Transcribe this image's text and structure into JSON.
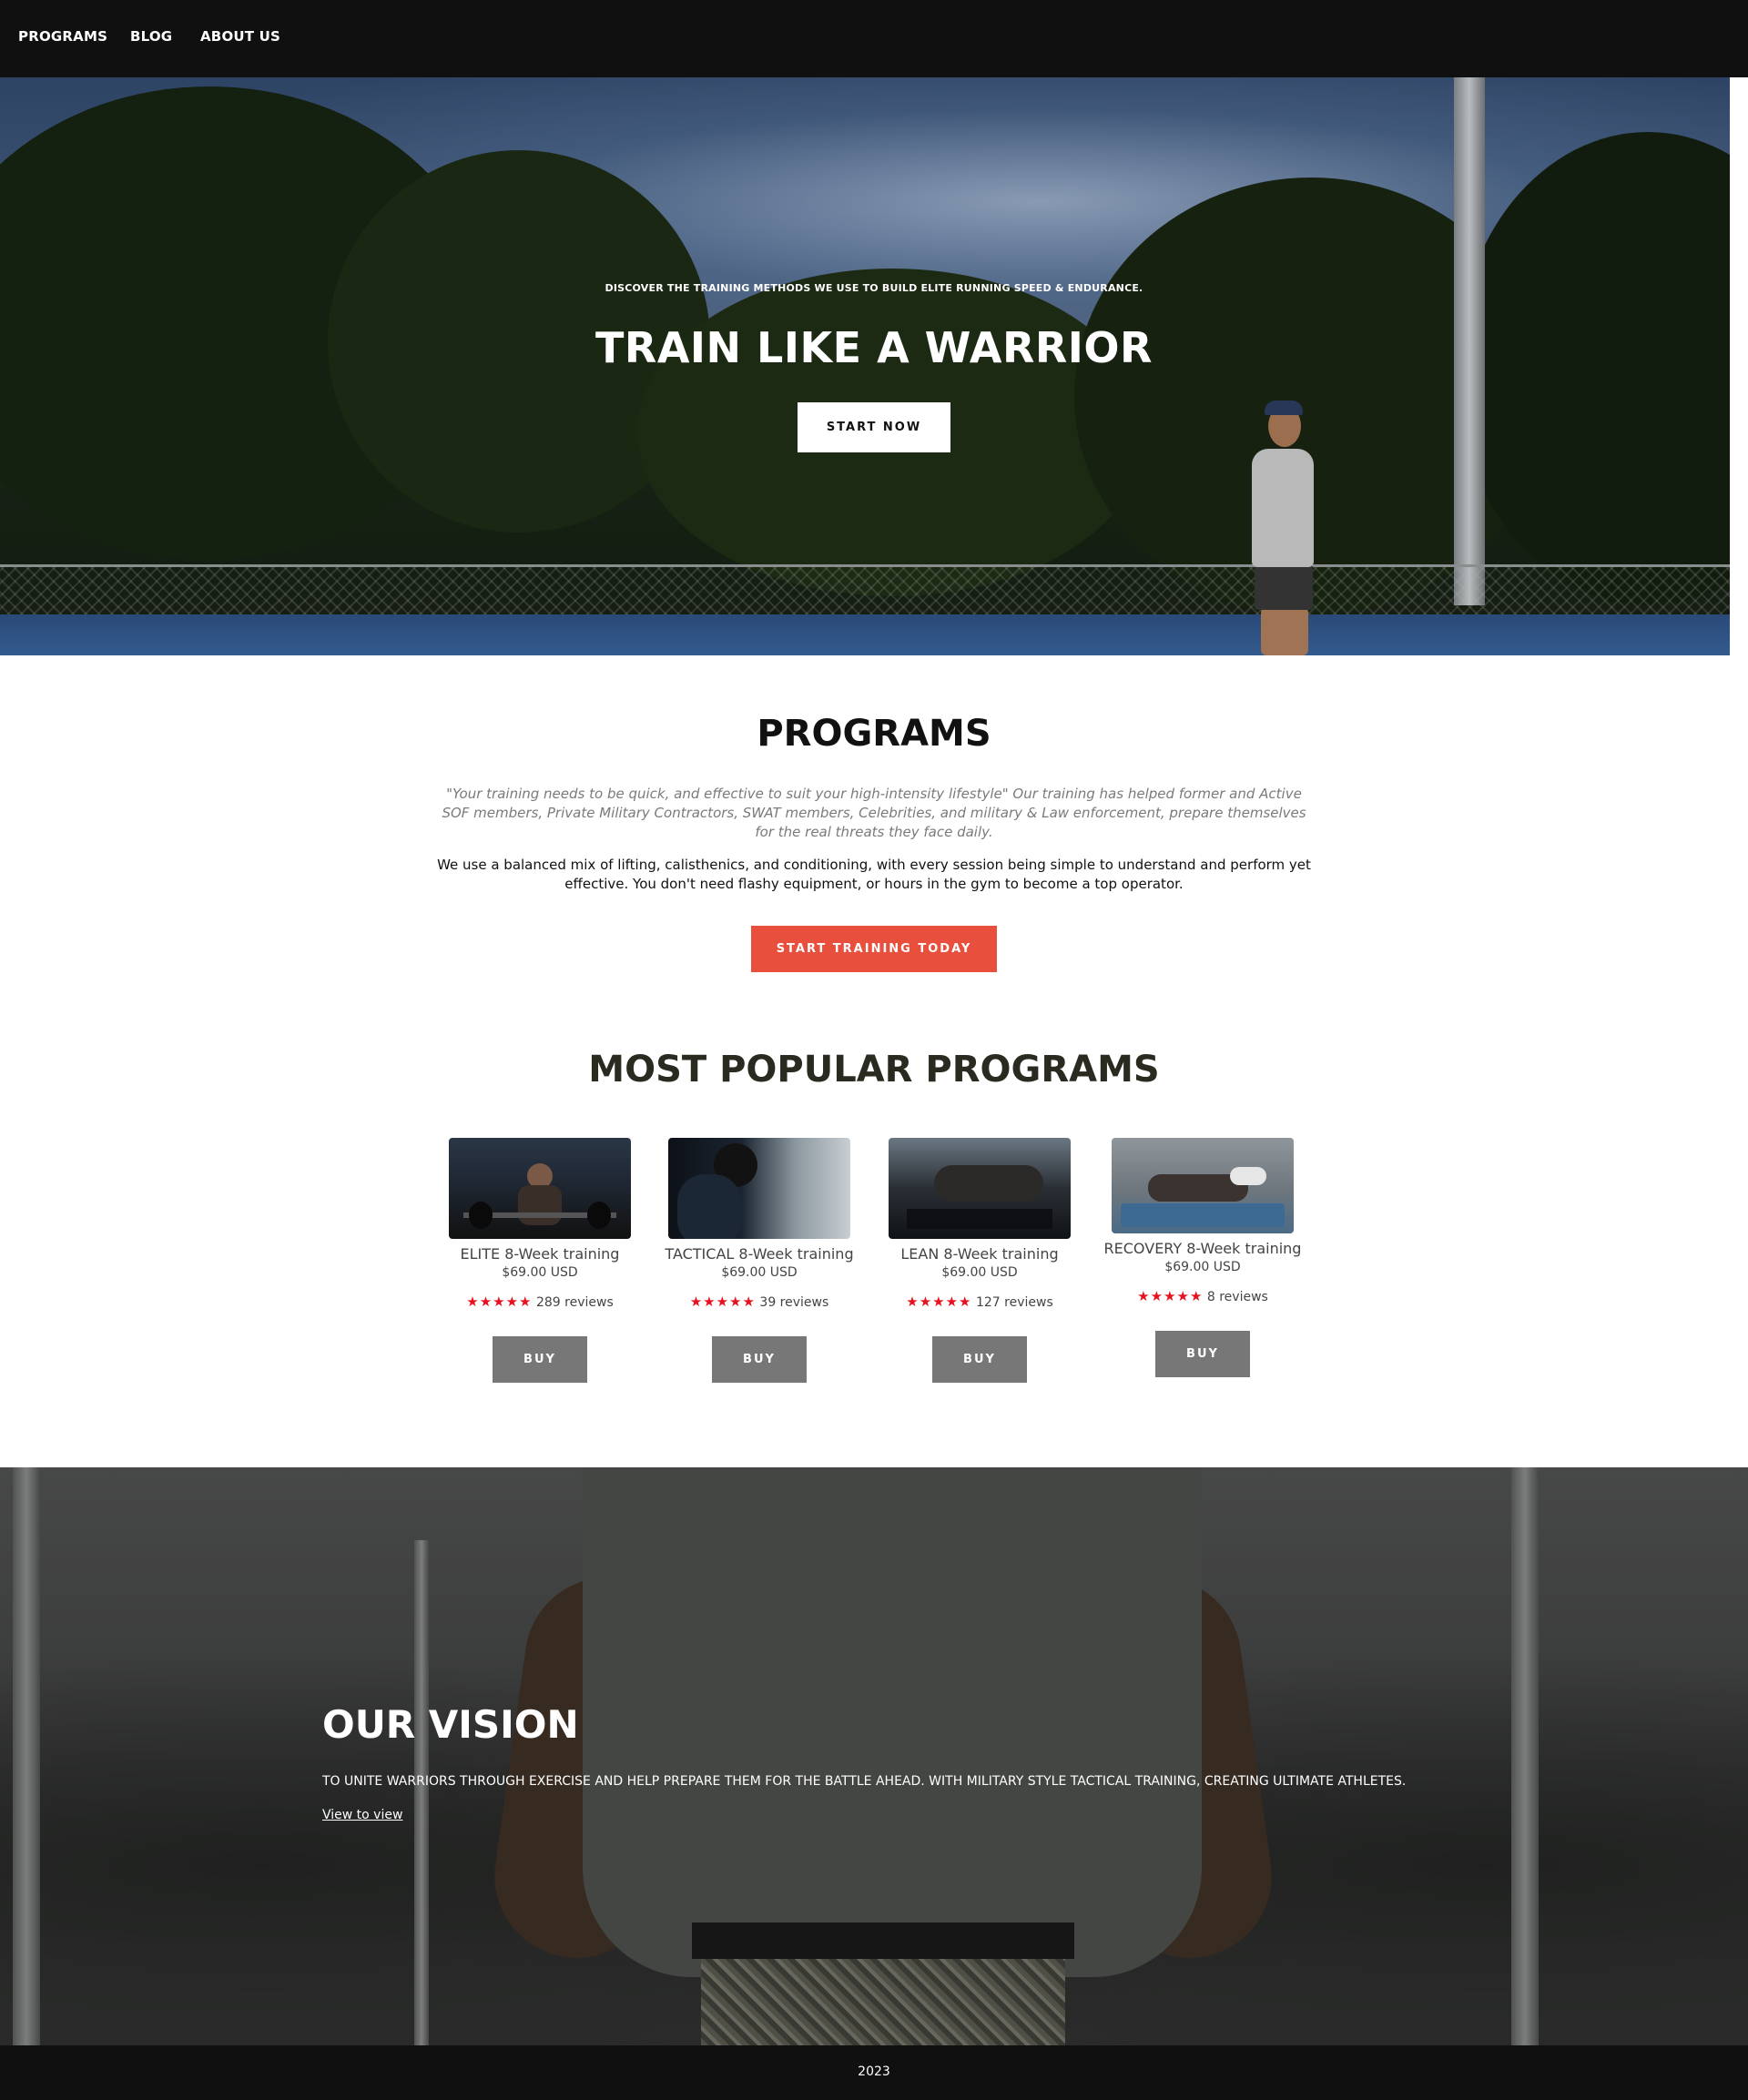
{
  "nav": {
    "items": [
      "PROGRAMS",
      "BLOG",
      "ABOUT US"
    ]
  },
  "hero": {
    "eyebrow": "DISCOVER THE TRAINING METHODS WE USE TO BUILD ELITE RUNNING SPEED & ENDURANCE.",
    "title": "TRAIN LIKE A WARRIOR",
    "cta_label": "START NOW"
  },
  "programs": {
    "title": "PROGRAMS",
    "quote": "\"Your training needs to be quick, and effective to suit your high-intensity lifestyle\" Our training has helped former and Active SOF members, Private Military Contractors, SWAT members, Celebrities, and military & Law enforcement, prepare themselves for the real threats they face daily.",
    "description": "We use a balanced mix of lifting, calisthenics, and conditioning, with every session being simple to understand and perform yet effective. You don't need flashy equipment, or hours in the gym to become a top operator.",
    "cta_label": "START TRAINING TODAY"
  },
  "popular": {
    "title": "MOST POPULAR PROGRAMS",
    "star_color": "#e8101f",
    "cards": [
      {
        "title": "ELITE 8-Week training",
        "price": "$69.00 USD",
        "stars": "★★★★★",
        "reviews": "289 reviews",
        "buy_label": "BUY"
      },
      {
        "title": "TACTICAL 8-Week training",
        "price": "$69.00 USD",
        "stars": "★★★★★",
        "reviews": "39 reviews",
        "buy_label": "BUY"
      },
      {
        "title": "LEAN 8-Week training",
        "price": "$69.00 USD",
        "stars": "★★★★★",
        "reviews": "127 reviews",
        "buy_label": "BUY"
      },
      {
        "title": "RECOVERY 8-Week training",
        "price": "$69.00 USD",
        "stars": "★★★★★",
        "reviews": "8 reviews",
        "buy_label": "BUY"
      }
    ]
  },
  "vision": {
    "title": "OUR VISION",
    "text": "TO UNITE WARRIORS THROUGH EXERCISE AND HELP PREPARE THEM FOR THE BATTLE AHEAD. WITH MILITARY STYLE TACTICAL TRAINING, CREATING ULTIMATE ATHLETES.",
    "link_label": "View to view"
  },
  "footer": {
    "year": "2023"
  },
  "colors": {
    "accent": "#e84f3d",
    "nav_bg": "#101010",
    "buy_button": "#777777"
  }
}
